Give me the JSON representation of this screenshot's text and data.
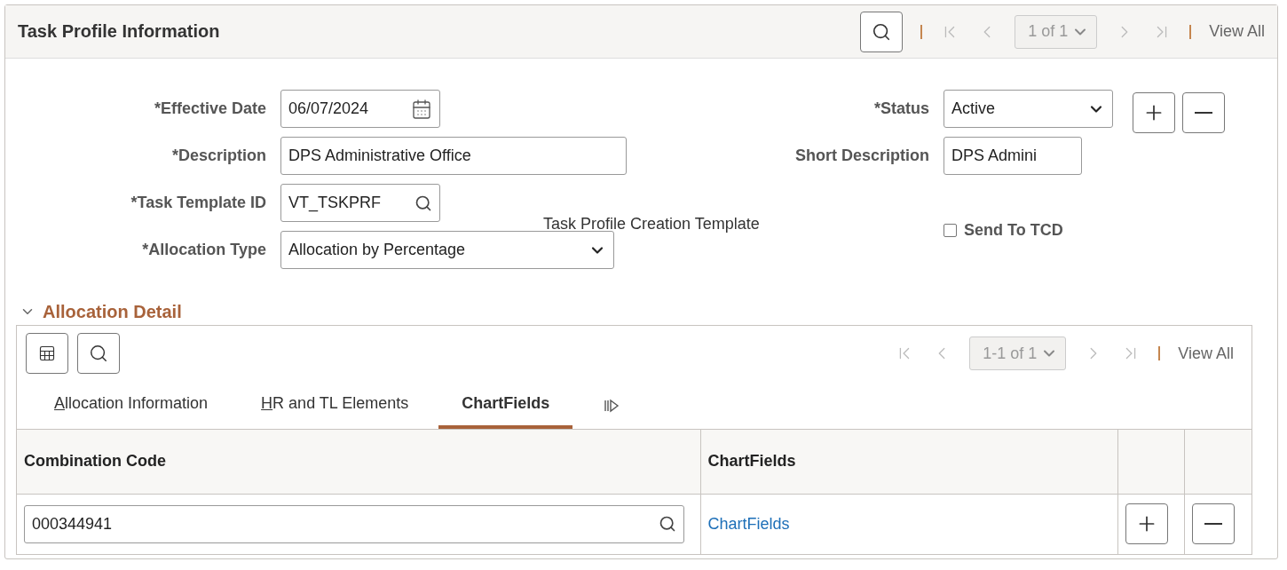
{
  "header": {
    "title": "Task Profile Information",
    "pager": {
      "nav": [
        {
          "kind": "first",
          "disabled": true
        },
        {
          "kind": "prev",
          "disabled": true
        }
      ],
      "select": "1 of 1",
      "nav_after": [
        {
          "kind": "next",
          "disabled": true
        },
        {
          "kind": "last",
          "disabled": true
        }
      ],
      "view_all": "View All"
    }
  },
  "form": {
    "left": [
      {
        "kind": "date",
        "label": "*Effective Date",
        "value": "06/07/2024"
      },
      {
        "kind": "text",
        "label": "*Description",
        "value": "DPS Administrative Office"
      },
      {
        "kind": "lookup",
        "label": "*Task Template ID",
        "value": "VT_TSKPRF",
        "note": "Task Profile Creation Template"
      },
      {
        "kind": "select",
        "label": "*Allocation Type",
        "value": "Allocation by Percentage"
      }
    ],
    "right": [
      {
        "kind": "select",
        "label": "*Status",
        "value": "Active"
      },
      {
        "kind": "text",
        "label": "Short Description",
        "value": "DPS Admini"
      },
      {
        "kind": "checkbox",
        "label": "Send To TCD",
        "checked": false
      }
    ]
  },
  "section": {
    "title": "Allocation Detail",
    "expanded": true,
    "pager": {
      "nav": [
        {
          "kind": "first",
          "disabled": true
        },
        {
          "kind": "prev",
          "disabled": true
        }
      ],
      "select": "1-1 of 1",
      "nav_after": [
        {
          "kind": "next",
          "disabled": true
        },
        {
          "kind": "last",
          "disabled": true
        }
      ],
      "view_all": "View All"
    },
    "tabs": [
      {
        "label": "Allocation Information",
        "selected": false,
        "underlined_key": true
      },
      {
        "label": "HR and TL Elements",
        "selected": false,
        "underlined_key": true
      },
      {
        "label": "ChartFields",
        "selected": true,
        "underlined_key": false
      }
    ],
    "table": {
      "columns": [
        "Combination Code",
        "ChartFields"
      ],
      "rows": [
        {
          "combination_code": "000344941",
          "chartfields_link": "ChartFields"
        }
      ]
    }
  }
}
